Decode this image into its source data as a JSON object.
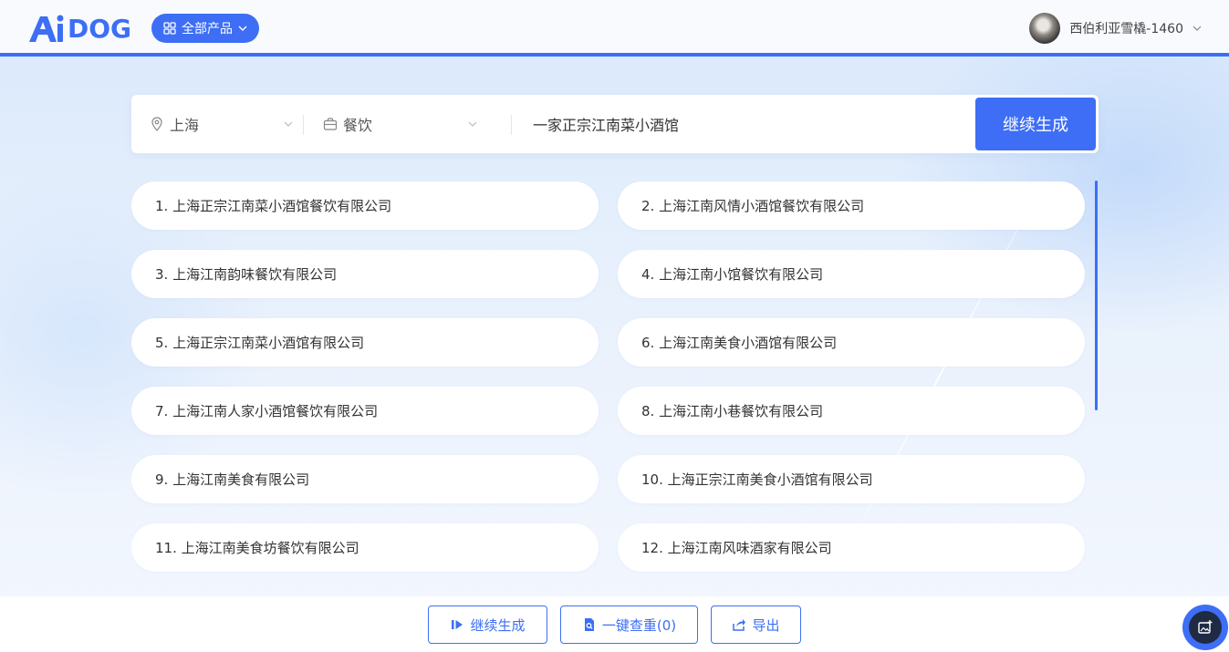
{
  "header": {
    "logo_text": "DOG",
    "products_label": "全部产品",
    "username": "西伯利亚雪橇-1460"
  },
  "search": {
    "city": "上海",
    "industry": "餐饮",
    "keyword": "一家正宗江南菜小酒馆",
    "generate_label": "继续生成"
  },
  "results": [
    "1. 上海正宗江南菜小酒馆餐饮有限公司",
    "2. 上海江南风情小酒馆餐饮有限公司",
    "3. 上海江南韵味餐饮有限公司",
    "4. 上海江南小馆餐饮有限公司",
    "5. 上海正宗江南菜小酒馆有限公司",
    "6. 上海江南美食小酒馆有限公司",
    "7. 上海江南人家小酒馆餐饮有限公司",
    "8. 上海江南小巷餐饮有限公司",
    "9. 上海江南美食有限公司",
    "10. 上海正宗江南美食小酒馆有限公司",
    "11. 上海江南美食坊餐饮有限公司",
    "12. 上海江南风味酒家有限公司"
  ],
  "footer": {
    "continue_label": "继续生成",
    "check_label": "一键查重(0)",
    "export_label": "导出"
  },
  "colors": {
    "accent": "#3d6ef5"
  }
}
